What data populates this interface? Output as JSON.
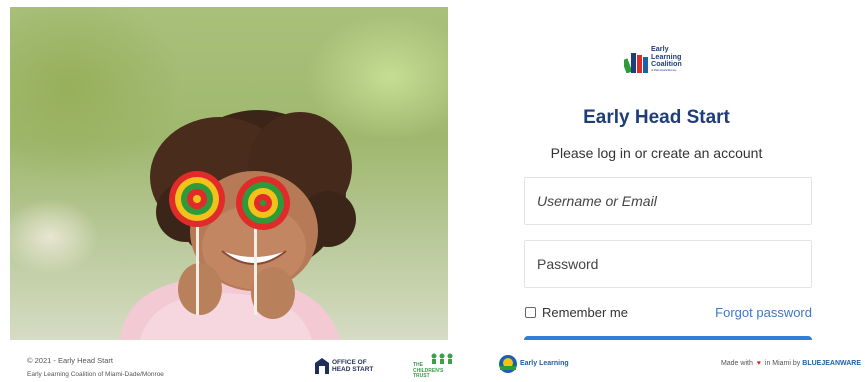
{
  "brand": {
    "logo_lines": [
      "Early",
      "Learning",
      "Coalition"
    ],
    "logo_sub": "of Miami-Dade/Monroe",
    "colors": {
      "navy": "#1f3d7a",
      "link": "#3a7ac4",
      "button": "#2f7fd8"
    }
  },
  "login": {
    "title": "Early Head Start",
    "subtitle": "Please log in or create an account",
    "username_placeholder": "Username or Email",
    "password_placeholder": "Password",
    "remember_label": "Remember me",
    "forgot_label": "Forgot password"
  },
  "footer": {
    "copyright": "© 2021 - Early Head Start",
    "org": "Early Learning Coalition of Miami-Dade/Monroe",
    "partners": {
      "ohs": "OFFICE OF\nHEAD START",
      "trust": "THE\nCHILDREN'S\nTRUST",
      "del": "Early Learning"
    },
    "made_prefix": "Made with",
    "made_mid": "in Miami by",
    "made_brand": "BLUEJEANWARE"
  }
}
